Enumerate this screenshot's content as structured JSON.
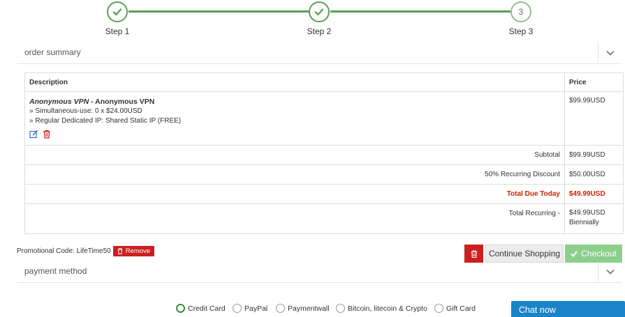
{
  "stepper": {
    "steps": [
      {
        "label": "Step 1",
        "state": "complete"
      },
      {
        "label": "Step 2",
        "state": "complete"
      },
      {
        "label": "Step 3",
        "number": "3",
        "state": "current"
      }
    ]
  },
  "order_summary": {
    "title": "order summary",
    "toggle_icon": "chevron-down-icon",
    "table": {
      "headers": {
        "description": "Description",
        "price": "Price"
      },
      "item": {
        "product_italic": "Anonymous VPN",
        "product_separator": " - ",
        "product_name": "Anonymous VPN",
        "options": [
          "» Simultaneous-use: 0 x $24.00USD",
          "» Regular Dedicated IP: Shared Static IP (FREE)"
        ],
        "price": "$99.99USD"
      },
      "summary": [
        {
          "label": "Subtotal",
          "value": "$99.99USD",
          "highlight": false
        },
        {
          "label": "50% Recurring Discount",
          "value": "$50.00USD",
          "highlight": false
        },
        {
          "label": "Total Due Today",
          "value": "$49.99USD",
          "highlight": true
        },
        {
          "label": "Total Recurring -",
          "value": "$49.99USD",
          "value2": "Biennially",
          "highlight": false
        }
      ]
    }
  },
  "promo": {
    "text": "Promotional Code: LifeTime50",
    "remove_label": "Remove"
  },
  "actions": {
    "continue_label": "Continue Shopping",
    "checkout_label": "Checkout"
  },
  "payment_method": {
    "title": "payment method",
    "options": [
      {
        "label": "Credit Card",
        "selected": true
      },
      {
        "label": "PayPal",
        "selected": false
      },
      {
        "label": "Paymentwall",
        "selected": false
      },
      {
        "label": "Bitcoin, litecoin & Crypto",
        "selected": false
      },
      {
        "label": "Gift Card",
        "selected": false
      }
    ]
  },
  "chat": {
    "label": "Chat now"
  },
  "colors": {
    "accent_green": "#5aa05a",
    "checkout_green": "#8ccf8c",
    "danger_red": "#cc1f1f",
    "due_red": "#cc2200",
    "chat_blue": "#1b84c8"
  }
}
